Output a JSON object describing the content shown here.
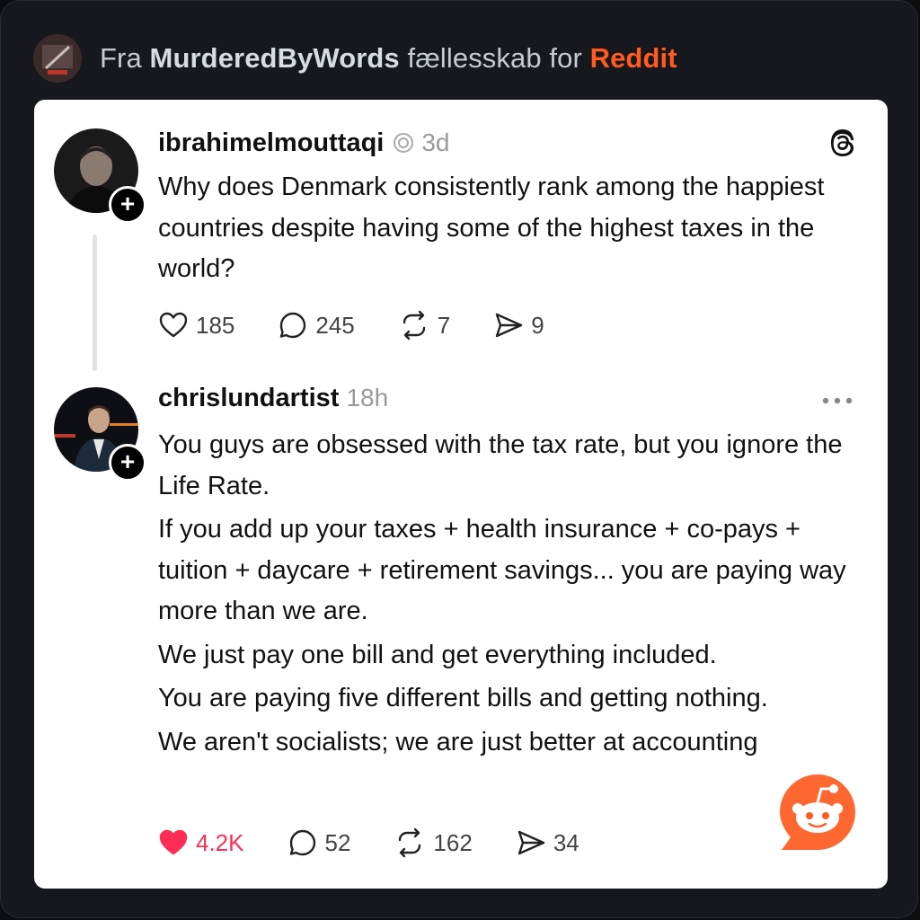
{
  "header": {
    "prefix": "Fra",
    "community": "MurderedByWords",
    "middle": "fællesskab for",
    "brand": "Reddit"
  },
  "posts": [
    {
      "username": "ibrahimelmouttaqi",
      "time": "3d",
      "text": [
        "Why does Denmark consistently rank among the happiest countries despite having some of the highest taxes in the world?"
      ],
      "stats": {
        "likes": "185",
        "comments": "245",
        "reposts": "7",
        "shares": "9"
      },
      "liked": false
    },
    {
      "username": "chrislundartist",
      "time": "18h",
      "text": [
        "You guys are obsessed with the tax rate, but you ignore the Life Rate.",
        "If you add up your taxes + health insurance + co-pays + tuition + daycare + retirement savings... you are paying way more than we are.",
        "We just pay one bill and get everything included.",
        "You are paying five different bills and getting nothing.",
        "We aren't socialists; we are just better at accounting"
      ],
      "stats": {
        "likes": "4.2K",
        "comments": "52",
        "reposts": "162",
        "shares": "34"
      },
      "liked": true
    }
  ],
  "colors": {
    "reddit_orange": "#ff5a1f",
    "like_red": "#ff2d55",
    "card_bg": "#ffffff",
    "page_bg": "#16181d"
  },
  "icons": [
    "threads-logo-icon",
    "verified-badge-icon",
    "heart-icon",
    "comment-icon",
    "repost-icon",
    "share-icon",
    "more-icon",
    "plus-icon",
    "reddit-snoo-icon"
  ]
}
